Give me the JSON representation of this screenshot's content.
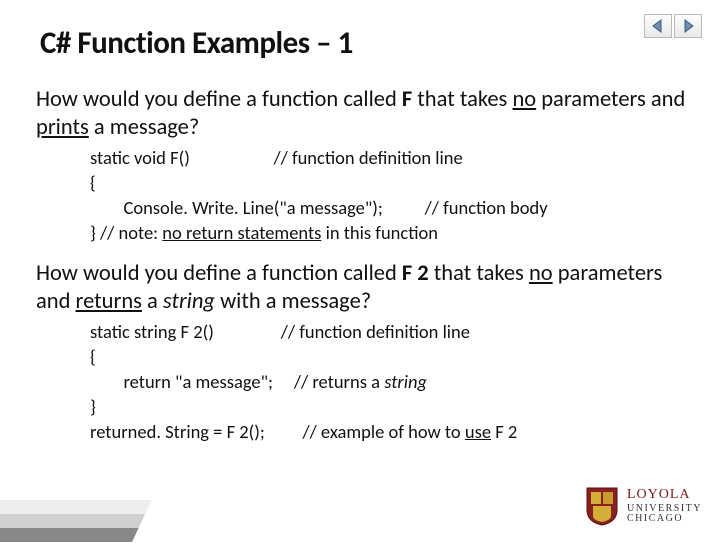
{
  "title": "C# Function Examples – 1",
  "bullets": [
    {
      "text_parts": [
        "How would you define a function called ",
        {
          "t": "F",
          "b": true
        },
        " that takes ",
        {
          "t": "no",
          "u": true
        },
        " parameters and ",
        {
          "t": "prints",
          "u": true
        },
        " a message?"
      ],
      "code_lines": [
        [
          {
            "t": "static void F()                    "
          },
          {
            "t": "// function definition line"
          }
        ],
        [
          {
            "t": "{"
          }
        ],
        [
          {
            "t": "        Console. Write. Line(\"a message\");          "
          },
          {
            "t": "// function body"
          }
        ],
        [
          {
            "t": "} "
          },
          {
            "t": "// note: "
          },
          {
            "t": "no return statements",
            "u": true
          },
          {
            "t": " in this function"
          }
        ]
      ]
    },
    {
      "text_parts": [
        "How would you define a function called ",
        {
          "t": "F 2",
          "b": true
        },
        " that takes ",
        {
          "t": "no",
          "u": true
        },
        " parameters and ",
        {
          "t": "returns",
          "u": true
        },
        " a ",
        {
          "t": "string",
          "i": true
        },
        " with a message?"
      ],
      "code_lines": [
        [
          {
            "t": "static string F 2()                "
          },
          {
            "t": "// function definition line"
          }
        ],
        [
          {
            "t": "{"
          }
        ],
        [
          {
            "t": "        return \"a message\";     "
          },
          {
            "t": "// returns a "
          },
          {
            "t": "string",
            "i": true
          }
        ],
        [
          {
            "t": "}"
          }
        ],
        [
          {
            "t": "returned. String = F 2();         "
          },
          {
            "t": "// example of how to "
          },
          {
            "t": "use",
            "u": true
          },
          {
            "t": " F 2"
          }
        ]
      ]
    }
  ],
  "logo": {
    "line1": "LOYOLA",
    "line2": "UNIVERSITY",
    "line3": "CHICAGO"
  }
}
